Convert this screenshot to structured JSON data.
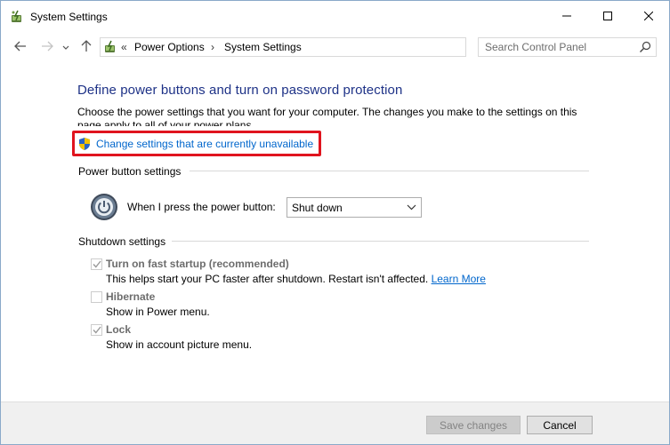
{
  "window": {
    "title": "System Settings",
    "icons": {
      "app": "power-options-icon",
      "minimize": "minimize-icon",
      "maximize": "maximize-icon",
      "close": "close-icon"
    }
  },
  "nav": {
    "icons": {
      "back": "back-arrow-icon",
      "forward": "forward-arrow-icon",
      "recent": "chevron-down-icon",
      "up": "up-arrow-icon",
      "refresh": "refresh-icon"
    },
    "breadcrumb": {
      "overflow": "«",
      "separator": "›",
      "items": [
        "Power Options",
        "System Settings"
      ]
    },
    "search": {
      "placeholder": "Search Control Panel",
      "value": ""
    }
  },
  "main": {
    "heading": "Define power buttons and turn on password protection",
    "description": "Choose the power settings that you want for your computer. The changes you make to the settings on this page apply to all of your power plans.",
    "change_link": "Change settings that are currently unavailable",
    "highlight_color": "#e0141e",
    "power_button_section": {
      "title": "Power button settings",
      "label": "When I press the power button:",
      "selected": "Shut down"
    },
    "shutdown_section": {
      "title": "Shutdown settings",
      "options": [
        {
          "title": "Turn on fast startup (recommended)",
          "description": "This helps start your PC faster after shutdown. Restart isn't affected.",
          "link": "Learn More",
          "checked": true,
          "enabled": false
        },
        {
          "title": "Hibernate",
          "description": "Show in Power menu.",
          "checked": false,
          "enabled": false
        },
        {
          "title": "Lock",
          "description": "Show in account picture menu.",
          "checked": true,
          "enabled": false
        }
      ]
    }
  },
  "footer": {
    "save_label": "Save changes",
    "cancel_label": "Cancel"
  }
}
